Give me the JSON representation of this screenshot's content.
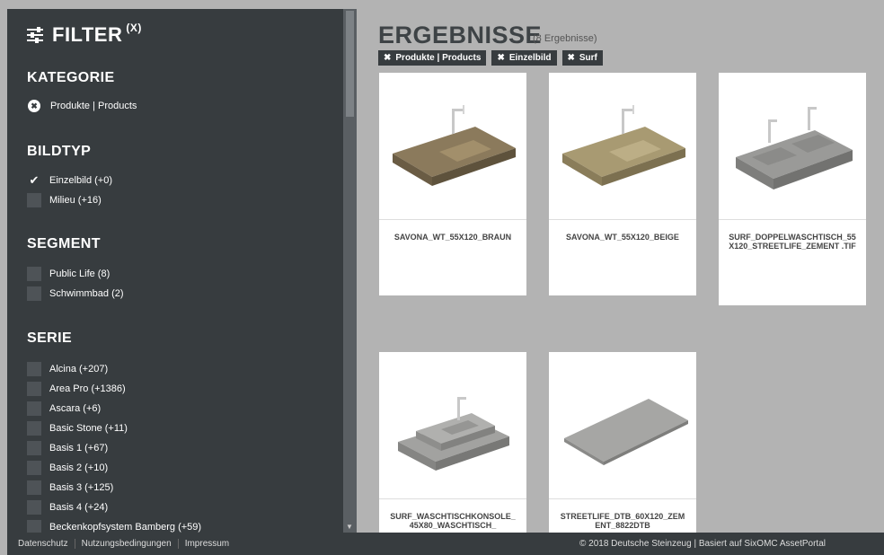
{
  "sidebar": {
    "title": "FILTER",
    "clear": "(X)",
    "sections": {
      "kategorie": {
        "heading": "KATEGORIE",
        "items": [
          "Produkte | Products"
        ]
      },
      "bildtyp": {
        "heading": "BILDTYP",
        "items": [
          "Einzelbild (+0)",
          "Milieu (+16)"
        ]
      },
      "segment": {
        "heading": "SEGMENT",
        "items": [
          "Public Life (8)",
          "Schwimmbad (2)"
        ]
      },
      "serie": {
        "heading": "SERIE",
        "items": [
          "Alcina (+207)",
          "Area Pro (+1386)",
          "Ascara (+6)",
          "Basic Stone (+11)",
          "Basis 1 (+67)",
          "Basis 2 (+10)",
          "Basis 3 (+125)",
          "Basis 4 (+24)",
          "Beckenkopfsystem Bamberg (+59)"
        ]
      }
    }
  },
  "main": {
    "title": "ERGEBNISSE",
    "count": "(8 Ergebnisse)",
    "chips": [
      "Produkte | Products",
      "Einzelbild",
      "Surf"
    ],
    "cards": [
      {
        "caption": "SAVONA_WT_55X120_BRAUN",
        "tone": "#8b7a5c"
      },
      {
        "caption": "SAVONA_WT_55X120_BEIGE",
        "tone": "#a89a72"
      },
      {
        "caption": "SURF_DOPPELWASCHTISCH_55X120_STREETLIFE_ZEMENT .TIF",
        "tone": "#9a9a98"
      },
      {
        "caption": "SURF_WASCHTISCHKONSOLE_45X80_WASCHTISCH_",
        "tone": "#a2a2a0"
      },
      {
        "caption": "STREETLIFE_DTB_60X120_ZEMENT_8822DTB",
        "tone": "#a6a6a4"
      }
    ]
  },
  "footer": {
    "links": [
      "Datenschutz",
      "Nutzungsbedingungen",
      "Impressum"
    ],
    "copyright": "© 2018 Deutsche Steinzeug | Basiert auf SixOMC AssetPortal"
  }
}
